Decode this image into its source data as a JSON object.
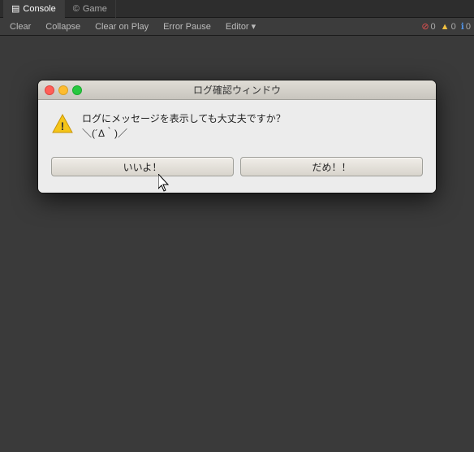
{
  "tabs": [
    {
      "label": "Console",
      "icon": "console",
      "active": true
    },
    {
      "label": "Game",
      "icon": "game",
      "active": false
    }
  ],
  "toolbar": {
    "clear_label": "Clear",
    "collapse_label": "Collapse",
    "clear_on_play_label": "Clear on Play",
    "error_pause_label": "Error Pause",
    "editor_label": "Editor",
    "badge_error": "0",
    "badge_warn": "0",
    "badge_info": "0"
  },
  "dialog": {
    "title": "ログ確認ウィンドウ",
    "message_line1": "ログにメッセージを表示しても大丈夫ですか？",
    "message_line2": "＼(´Δ｀)／",
    "btn_yes": "いいよ！",
    "btn_no": "だめ！！"
  }
}
